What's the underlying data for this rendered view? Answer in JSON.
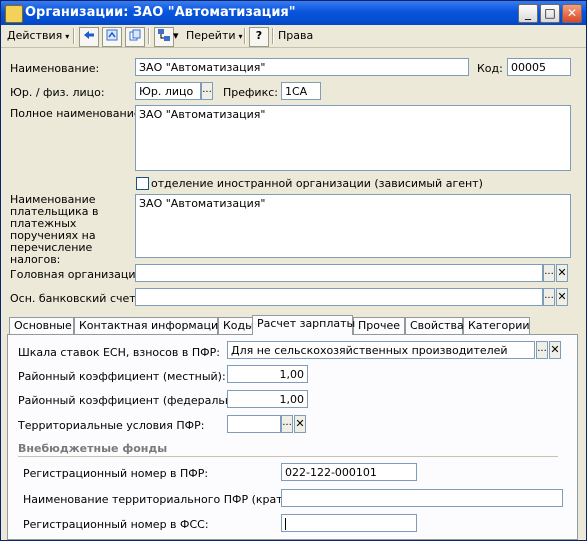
{
  "window": {
    "title": "Организации: ЗАО \"Автоматизация\""
  },
  "titlebar_buttons": {
    "minimize": "_",
    "maximize": "□",
    "close": "✕"
  },
  "toolbar": {
    "actions_label": "Действия",
    "goto_label": "Перейти",
    "help_label": "?",
    "rights_label": "Права"
  },
  "form": {
    "name_label": "Наименование:",
    "name_value": "ЗАО \"Автоматизация\"",
    "code_label": "Код:",
    "code_value": "00005",
    "entity_type_label": "Юр. / физ. лицо:",
    "entity_type_value": "Юр. лицо",
    "prefix_label": "Префикс:",
    "prefix_value": "1СА",
    "full_name_label": "Полное наименование:",
    "full_name_value": "ЗАО \"Автоматизация\"",
    "foreign_branch_label": "отделение иностранной организации (зависимый агент)",
    "foreign_branch_checked": false,
    "payer_name_label": "Наименование плательщика в платежных поручениях на перечисление налогов:",
    "payer_name_value": "ЗАО \"Автоматизация\"",
    "head_org_label": "Головная организация:",
    "head_org_value": "",
    "bank_account_label": "Осн. банковский счет:",
    "bank_account_value": ""
  },
  "tabs": [
    {
      "label": "Основные",
      "active": false
    },
    {
      "label": "Контактная информация",
      "active": false
    },
    {
      "label": "Коды",
      "active": false
    },
    {
      "label": "Расчет зарплаты",
      "active": true
    },
    {
      "label": "Прочее",
      "active": false
    },
    {
      "label": "Свойства",
      "active": false
    },
    {
      "label": "Категории",
      "active": false
    }
  ],
  "payroll": {
    "esn_scale_label": "Шкала ставок ЕСН, взносов в ПФР:",
    "esn_scale_value": "Для не сельскохозяйственных производителей",
    "district_local_label": "Районный коэффициент (местный):",
    "district_local_value": "1,00",
    "district_federal_label": "Районный коэффициент (федеральный):",
    "district_federal_value": "1,00",
    "territorial_label": "Территориальные условия ПФР:",
    "territorial_value": "",
    "funds_section_title": "Внебюджетные фонды",
    "pfr_reg_label": "Регистрационный номер в ПФР:",
    "pfr_reg_value": "022-122-000101",
    "pfr_territorial_label": "Наименование территориального ПФР (краткое):",
    "pfr_territorial_value": "",
    "fss_reg_label": "Регистрационный номер в  ФСС:",
    "fss_reg_value": ""
  },
  "icons": {
    "select_glyph": "...",
    "clear_glyph": "✕",
    "dropdown_glyph": "▾"
  }
}
